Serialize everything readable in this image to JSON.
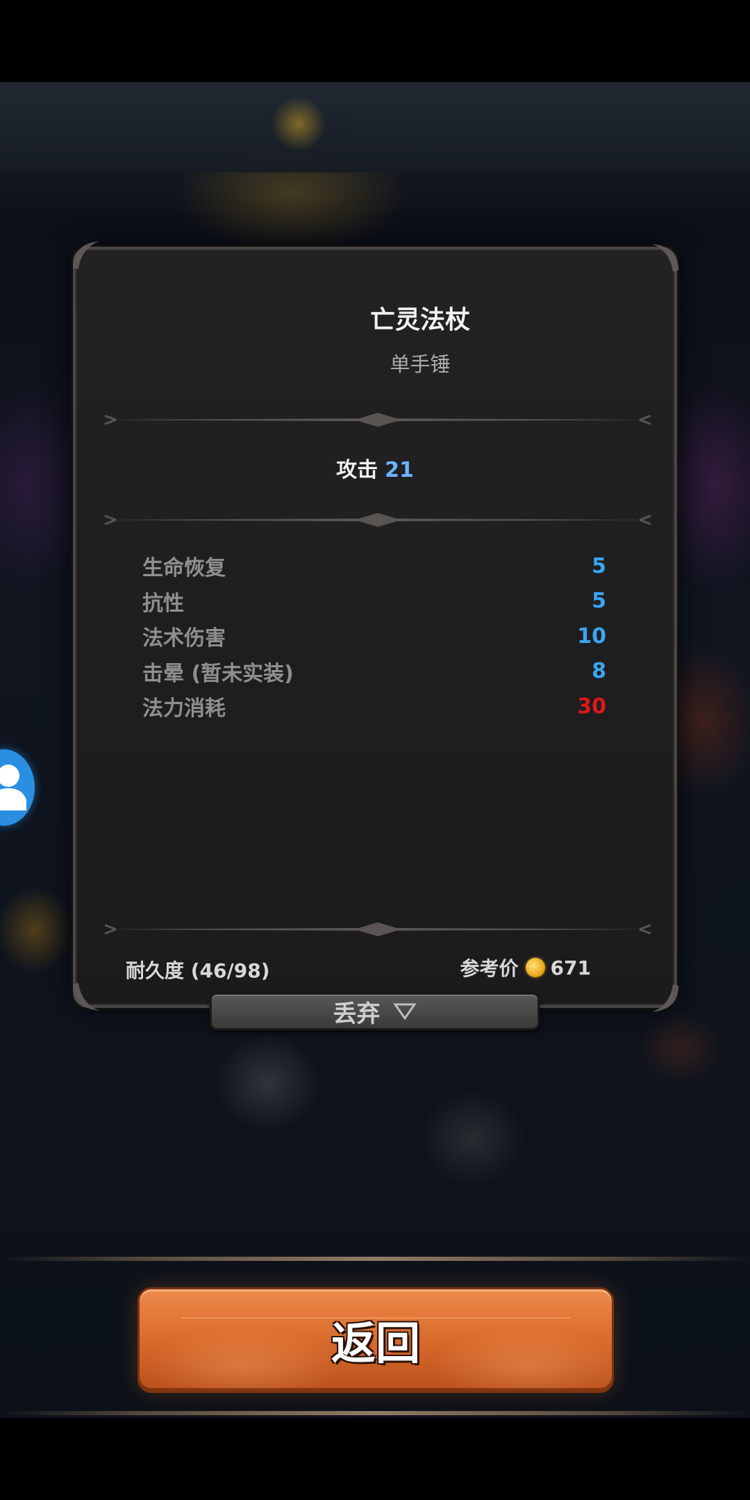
{
  "item": {
    "name": "亡灵法杖",
    "type": "单手锤",
    "attack_label": "攻击",
    "attack_value": "21",
    "stats": [
      {
        "label": "生命恢复",
        "value": "5",
        "color": "#3aa6f0"
      },
      {
        "label": "抗性",
        "value": "5",
        "color": "#3aa6f0"
      },
      {
        "label": "法术伤害",
        "value": "10",
        "color": "#3aa6f0"
      },
      {
        "label": "击晕 (暂未实装)",
        "value": "8",
        "color": "#3aa6f0"
      },
      {
        "label": "法力消耗",
        "value": "30",
        "color": "#e01818"
      }
    ],
    "durability": "耐久度 (46/98)",
    "price_label": "参考价",
    "price_value": "671"
  },
  "actions": {
    "discard_label": "丢弃",
    "back_label": "返回"
  },
  "icons": {
    "coin": "gold-coin-icon",
    "discard_arrow": "triangle-down-icon",
    "avatar": "user-icon"
  },
  "colors": {
    "stat_positive": "#3aa6f0",
    "stat_cost": "#e01818",
    "back_button": "#d96b2c"
  }
}
